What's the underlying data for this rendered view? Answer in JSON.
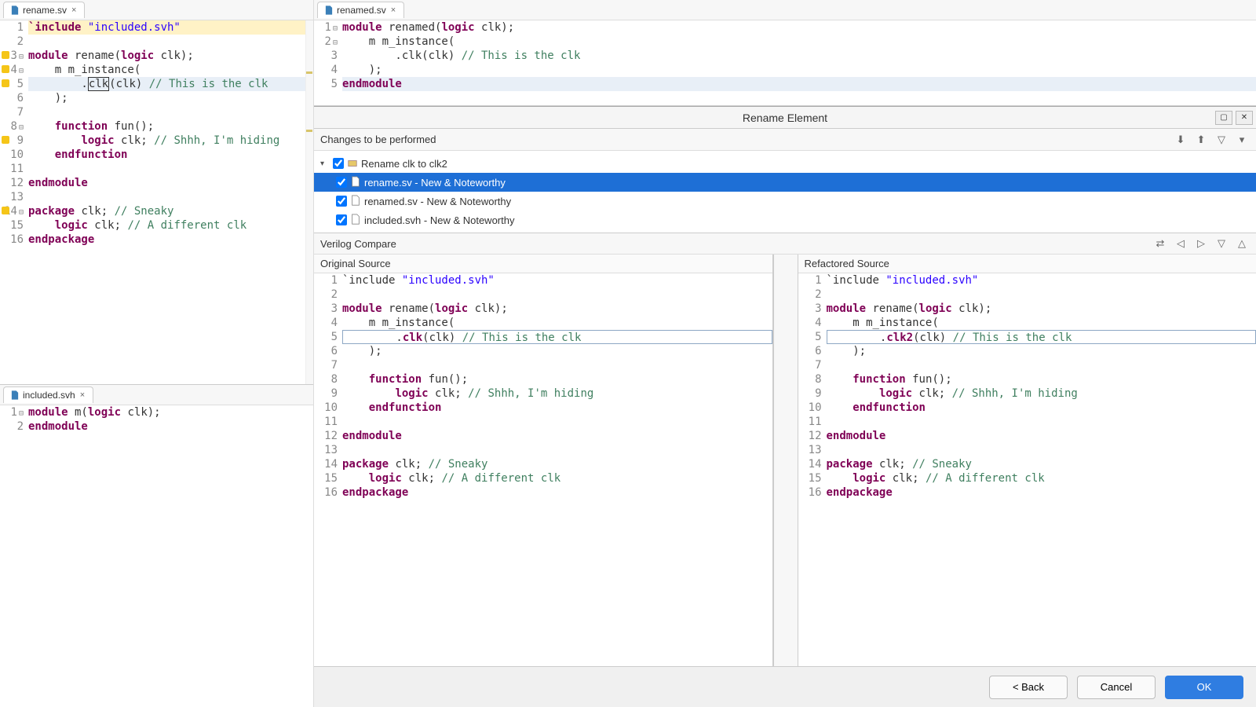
{
  "tabs": {
    "left_top": "rename.sv",
    "left_bot": "included.svh",
    "right": "renamed.sv"
  },
  "editors": {
    "rename_sv": [
      {
        "n": 1,
        "seg": [
          [
            "kw",
            "`include "
          ],
          [
            "str",
            "\"included.svh\""
          ]
        ],
        "hl": "inc"
      },
      {
        "n": 2,
        "seg": [
          [
            "",
            ""
          ]
        ]
      },
      {
        "n": 3,
        "seg": [
          [
            "kw",
            "module"
          ],
          [
            "",
            " rename("
          ],
          [
            "kw",
            "logic"
          ],
          [
            "",
            " clk);"
          ]
        ],
        "mk": true,
        "fold": true
      },
      {
        "n": 4,
        "seg": [
          [
            "",
            "    m m_instance("
          ]
        ],
        "mk": true,
        "fold": true
      },
      {
        "n": 5,
        "seg": [
          [
            "",
            "        ."
          ],
          [
            "sel",
            "clk"
          ],
          [
            "",
            "(clk) "
          ],
          [
            "cmt",
            "// This is the clk"
          ]
        ],
        "mk": true,
        "cur": true
      },
      {
        "n": 6,
        "seg": [
          [
            "",
            "    );"
          ]
        ]
      },
      {
        "n": 7,
        "seg": [
          [
            "",
            ""
          ]
        ]
      },
      {
        "n": 8,
        "seg": [
          [
            "",
            "    "
          ],
          [
            "kw",
            "function"
          ],
          [
            "",
            " fun();"
          ]
        ],
        "fold": true
      },
      {
        "n": 9,
        "seg": [
          [
            "",
            "        "
          ],
          [
            "kw",
            "logic"
          ],
          [
            "",
            " clk; "
          ],
          [
            "cmt",
            "// Shhh, I'm hiding"
          ]
        ],
        "mk": true
      },
      {
        "n": 10,
        "seg": [
          [
            "",
            "    "
          ],
          [
            "kw",
            "endfunction"
          ]
        ]
      },
      {
        "n": 11,
        "seg": [
          [
            "",
            ""
          ]
        ]
      },
      {
        "n": 12,
        "seg": [
          [
            "kw",
            "endmodule"
          ]
        ]
      },
      {
        "n": 13,
        "seg": [
          [
            "",
            ""
          ]
        ]
      },
      {
        "n": 14,
        "seg": [
          [
            "kw",
            "package"
          ],
          [
            "",
            " clk; "
          ],
          [
            "cmt",
            "// Sneaky"
          ]
        ],
        "mk": true,
        "fold": true
      },
      {
        "n": 15,
        "seg": [
          [
            "",
            "    "
          ],
          [
            "kw",
            "logic"
          ],
          [
            "",
            " clk; "
          ],
          [
            "cmt",
            "// A different clk"
          ]
        ]
      },
      {
        "n": 16,
        "seg": [
          [
            "kw",
            "endpackage"
          ]
        ]
      }
    ],
    "included_svh": [
      {
        "n": 1,
        "seg": [
          [
            "kw",
            "module"
          ],
          [
            "",
            " m("
          ],
          [
            "kw",
            "logic"
          ],
          [
            "",
            " clk);"
          ]
        ],
        "fold": true
      },
      {
        "n": 2,
        "seg": [
          [
            "kw",
            "endmodule"
          ]
        ]
      }
    ],
    "renamed_sv": [
      {
        "n": 1,
        "seg": [
          [
            "kw",
            "module"
          ],
          [
            "",
            " renamed("
          ],
          [
            "kw",
            "logic"
          ],
          [
            "",
            " clk);"
          ]
        ],
        "fold": true
      },
      {
        "n": 2,
        "seg": [
          [
            "",
            "    m m_instance("
          ]
        ],
        "fold": true
      },
      {
        "n": 3,
        "seg": [
          [
            "",
            "        .clk(clk) "
          ],
          [
            "cmt",
            "// This is the clk"
          ]
        ]
      },
      {
        "n": 4,
        "seg": [
          [
            "",
            "    );"
          ]
        ]
      },
      {
        "n": 5,
        "seg": [
          [
            "kw",
            "endmodule"
          ]
        ],
        "cur": true
      }
    ]
  },
  "dialog": {
    "title": "Rename Element",
    "changes_hdr": "Changes to be performed",
    "tree_root": "Rename clk to clk2",
    "tree_items": [
      "rename.sv - New & Noteworthy",
      "renamed.sv - New & Noteworthy",
      "included.svh - New & Noteworthy"
    ],
    "compare_hdr": "Verilog Compare",
    "orig_label": "Original Source",
    "ref_label": "Refactored Source",
    "btn_back": "< Back",
    "btn_cancel": "Cancel",
    "btn_ok": "OK"
  },
  "compare": {
    "orig": [
      {
        "n": 1,
        "seg": [
          [
            "",
            "`include "
          ],
          [
            "str",
            "\"included.svh\""
          ]
        ]
      },
      {
        "n": 2,
        "seg": [
          [
            "",
            ""
          ]
        ]
      },
      {
        "n": 3,
        "seg": [
          [
            "kw",
            "module"
          ],
          [
            "",
            " rename("
          ],
          [
            "kw",
            "logic"
          ],
          [
            "",
            " clk);"
          ]
        ]
      },
      {
        "n": 4,
        "seg": [
          [
            "",
            "    m m_instance("
          ]
        ]
      },
      {
        "n": 5,
        "seg": [
          [
            "",
            "        ."
          ],
          [
            "kw",
            "clk"
          ],
          [
            "",
            "(clk) "
          ],
          [
            "cmt",
            "// This is the clk"
          ]
        ],
        "diff": true
      },
      {
        "n": 6,
        "seg": [
          [
            "",
            "    );"
          ]
        ]
      },
      {
        "n": 7,
        "seg": [
          [
            "",
            ""
          ]
        ]
      },
      {
        "n": 8,
        "seg": [
          [
            "",
            "    "
          ],
          [
            "kw",
            "function"
          ],
          [
            "",
            " fun();"
          ]
        ]
      },
      {
        "n": 9,
        "seg": [
          [
            "",
            "        "
          ],
          [
            "kw",
            "logic"
          ],
          [
            "",
            " clk; "
          ],
          [
            "cmt",
            "// Shhh, I'm hiding"
          ]
        ]
      },
      {
        "n": 10,
        "seg": [
          [
            "",
            "    "
          ],
          [
            "kw",
            "endfunction"
          ]
        ]
      },
      {
        "n": 11,
        "seg": [
          [
            "",
            ""
          ]
        ]
      },
      {
        "n": 12,
        "seg": [
          [
            "kw",
            "endmodule"
          ]
        ]
      },
      {
        "n": 13,
        "seg": [
          [
            "",
            ""
          ]
        ]
      },
      {
        "n": 14,
        "seg": [
          [
            "kw",
            "package"
          ],
          [
            "",
            " clk; "
          ],
          [
            "cmt",
            "// Sneaky"
          ]
        ]
      },
      {
        "n": 15,
        "seg": [
          [
            "",
            "    "
          ],
          [
            "kw",
            "logic"
          ],
          [
            "",
            " clk; "
          ],
          [
            "cmt",
            "// A different clk"
          ]
        ]
      },
      {
        "n": 16,
        "seg": [
          [
            "kw",
            "endpackage"
          ]
        ]
      }
    ],
    "ref": [
      {
        "n": 1,
        "seg": [
          [
            "",
            "`include "
          ],
          [
            "str",
            "\"included.svh\""
          ]
        ]
      },
      {
        "n": 2,
        "seg": [
          [
            "",
            ""
          ]
        ]
      },
      {
        "n": 3,
        "seg": [
          [
            "kw",
            "module"
          ],
          [
            "",
            " rename("
          ],
          [
            "kw",
            "logic"
          ],
          [
            "",
            " clk);"
          ]
        ]
      },
      {
        "n": 4,
        "seg": [
          [
            "",
            "    m m_instance("
          ]
        ]
      },
      {
        "n": 5,
        "seg": [
          [
            "",
            "        ."
          ],
          [
            "kw",
            "clk2"
          ],
          [
            "",
            "(clk) "
          ],
          [
            "cmt",
            "// This is the clk"
          ]
        ],
        "diff": true
      },
      {
        "n": 6,
        "seg": [
          [
            "",
            "    );"
          ]
        ]
      },
      {
        "n": 7,
        "seg": [
          [
            "",
            ""
          ]
        ]
      },
      {
        "n": 8,
        "seg": [
          [
            "",
            "    "
          ],
          [
            "kw",
            "function"
          ],
          [
            "",
            " fun();"
          ]
        ]
      },
      {
        "n": 9,
        "seg": [
          [
            "",
            "        "
          ],
          [
            "kw",
            "logic"
          ],
          [
            "",
            " clk; "
          ],
          [
            "cmt",
            "// Shhh, I'm hiding"
          ]
        ]
      },
      {
        "n": 10,
        "seg": [
          [
            "",
            "    "
          ],
          [
            "kw",
            "endfunction"
          ]
        ]
      },
      {
        "n": 11,
        "seg": [
          [
            "",
            ""
          ]
        ]
      },
      {
        "n": 12,
        "seg": [
          [
            "kw",
            "endmodule"
          ]
        ]
      },
      {
        "n": 13,
        "seg": [
          [
            "",
            ""
          ]
        ]
      },
      {
        "n": 14,
        "seg": [
          [
            "kw",
            "package"
          ],
          [
            "",
            " clk; "
          ],
          [
            "cmt",
            "// Sneaky"
          ]
        ]
      },
      {
        "n": 15,
        "seg": [
          [
            "",
            "    "
          ],
          [
            "kw",
            "logic"
          ],
          [
            "",
            " clk; "
          ],
          [
            "cmt",
            "// A different clk"
          ]
        ]
      },
      {
        "n": 16,
        "seg": [
          [
            "kw",
            "endpackage"
          ]
        ]
      }
    ]
  }
}
